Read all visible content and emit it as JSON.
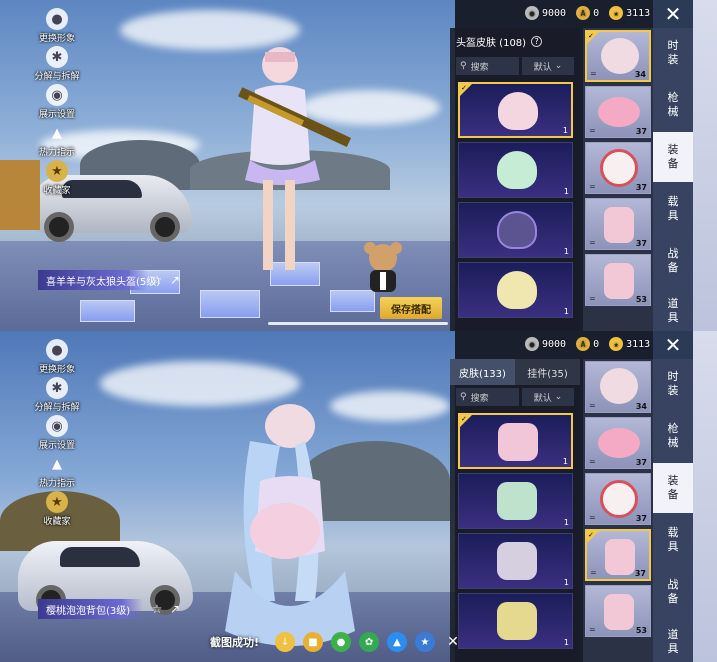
{
  "currency": [
    {
      "icon": "coin-dark-icon",
      "value": "9000"
    },
    {
      "icon": "a-coin-icon",
      "value": "0"
    },
    {
      "icon": "uc-icon",
      "value": "3113"
    }
  ],
  "left_menu": [
    {
      "icon": "user-icon",
      "label": "更换形象"
    },
    {
      "icon": "puzzle-icon",
      "label": "分解与拆解"
    },
    {
      "icon": "eye-icon",
      "label": "展示设置"
    },
    {
      "icon": "fire-icon",
      "label": "热力指示"
    },
    {
      "icon": "badge-icon",
      "label": "收藏家"
    }
  ],
  "categories": [
    {
      "label": "时\n装"
    },
    {
      "label": "枪\n械"
    },
    {
      "label": "装\n备"
    },
    {
      "label": "载\n具"
    },
    {
      "label": "战\n备"
    },
    {
      "label": "道\n具"
    }
  ],
  "panel1": {
    "inventory_header": "头盔皮肤 (108)",
    "search_label": "搜索",
    "sort_label": "默认",
    "item_name": "喜羊羊与灰太狼头盔(5级)",
    "save_label": "保存搭配",
    "items": [
      {
        "count": "1",
        "selected": true
      },
      {
        "count": "1",
        "selected": false
      },
      {
        "count": "1",
        "selected": false
      },
      {
        "count": "1",
        "selected": false
      }
    ],
    "slots": [
      {
        "count": "34",
        "selected": true
      },
      {
        "count": "37",
        "selected": false
      },
      {
        "count": "37",
        "selected": false
      },
      {
        "count": "37",
        "selected": false
      },
      {
        "count": "53",
        "selected": false
      }
    ]
  },
  "panel2": {
    "tab_active": "皮肤(133)",
    "tab_inactive": "挂件(35)",
    "search_label": "搜索",
    "sort_label": "默认",
    "item_name": "樱桃泡泡背包(3级)",
    "items": [
      {
        "count": "1",
        "selected": true
      },
      {
        "count": "1",
        "selected": false
      },
      {
        "count": "1",
        "selected": false
      },
      {
        "count": "1",
        "selected": false
      }
    ],
    "slots": [
      {
        "count": "34",
        "selected": false
      },
      {
        "count": "37",
        "selected": false
      },
      {
        "count": "37",
        "selected": false
      },
      {
        "count": "37",
        "selected": true
      },
      {
        "count": "53",
        "selected": false
      }
    ]
  },
  "screenshot_bar": {
    "label": "截图成功!"
  }
}
